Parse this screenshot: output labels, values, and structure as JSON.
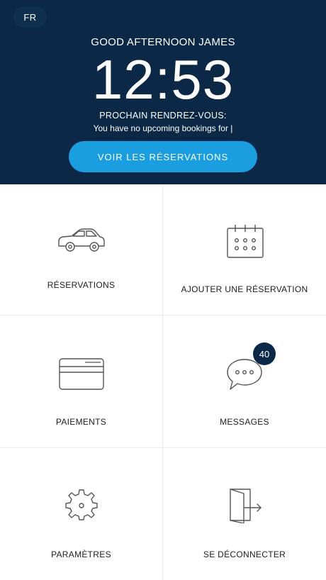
{
  "header": {
    "language": "FR",
    "greeting": "GOOD AFTERNOON JAMES",
    "time": "12:53",
    "next_appointment_label": "PROCHAIN RENDREZ-VOUS:",
    "next_appointment_text": "You have no upcoming bookings for |",
    "cta_label": "VOIR LES RÉSERVATIONS"
  },
  "tiles": [
    {
      "label": "RÉSERVATIONS",
      "icon": "car-icon"
    },
    {
      "label": "AJOUTER UNE RÉSERVATION",
      "icon": "calendar-icon"
    },
    {
      "label": "PAIEMENTS",
      "icon": "credit-card-icon"
    },
    {
      "label": "MESSAGES",
      "icon": "chat-bubble-icon",
      "badge": "40"
    },
    {
      "label": "PARAMÈTRES",
      "icon": "gear-icon"
    },
    {
      "label": "SE DÉCONNECTER",
      "icon": "logout-icon"
    }
  ],
  "colors": {
    "header_bg": "#0b2946",
    "accent": "#1a9ee0",
    "badge_bg": "#0b2946"
  }
}
